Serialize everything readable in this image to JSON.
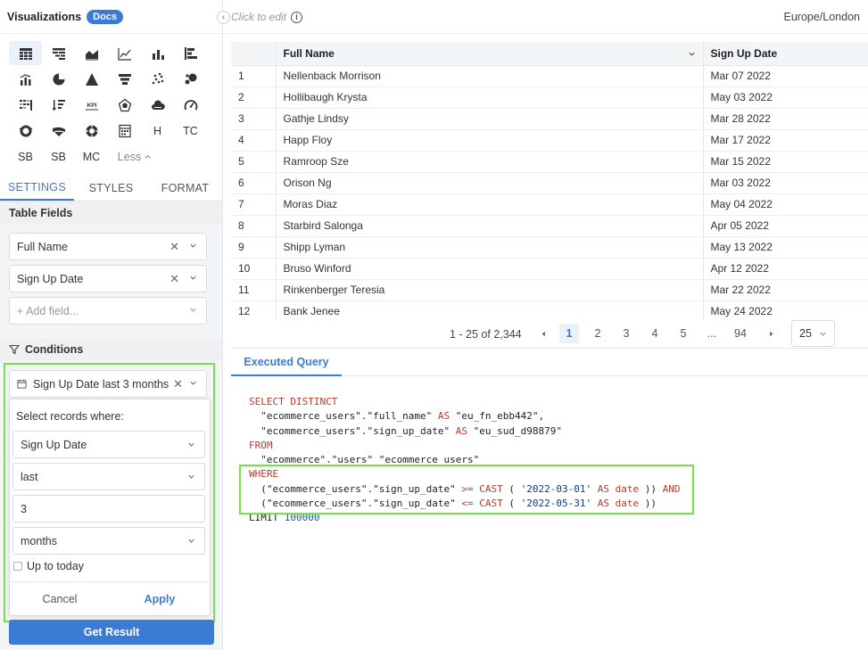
{
  "sidebar": {
    "title": "Visualizations",
    "docs_badge": "Docs",
    "viz_text_icons": [
      "H",
      "TC",
      "SB",
      "SB",
      "MC"
    ],
    "less_label": "Less",
    "tabs": [
      "SETTINGS",
      "STYLES",
      "FORMAT"
    ],
    "table_fields_title": "Table Fields",
    "fields": [
      "Full Name",
      "Sign Up Date"
    ],
    "add_field_placeholder": "+ Add field...",
    "conditions_title": "Conditions",
    "condition_chip": "Sign Up Date last 3 months",
    "popup": {
      "label": "Select records where:",
      "field": "Sign Up Date",
      "operator": "last",
      "value": "3",
      "unit": "months",
      "up_to_today": "Up to today",
      "cancel": "Cancel",
      "apply": "Apply"
    },
    "get_result": "Get Result"
  },
  "topbar": {
    "click_to_edit": "Click to edit",
    "timezone": "Europe/London"
  },
  "table": {
    "columns": [
      "Full Name",
      "Sign Up Date"
    ],
    "rows": [
      [
        "1",
        "Nellenback Morrison",
        "Mar 07 2022"
      ],
      [
        "2",
        "Hollibaugh Krysta",
        "May 03 2022"
      ],
      [
        "3",
        "Gathje Lindsy",
        "Mar 28 2022"
      ],
      [
        "4",
        "Happ Floy",
        "Mar 17 2022"
      ],
      [
        "5",
        "Ramroop Sze",
        "Mar 15 2022"
      ],
      [
        "6",
        "Orison Ng",
        "Mar 03 2022"
      ],
      [
        "7",
        "Moras Diaz",
        "May 04 2022"
      ],
      [
        "8",
        "Starbird Salonga",
        "Apr 05 2022"
      ],
      [
        "9",
        "Shipp Lyman",
        "May 13 2022"
      ],
      [
        "10",
        "Bruso Winford",
        "Apr 12 2022"
      ],
      [
        "11",
        "Rinkenberger Teresia",
        "Mar 22 2022"
      ],
      [
        "12",
        "Bank Jenee",
        "May 24 2022"
      ]
    ]
  },
  "pagination": {
    "summary": "1 - 25 of 2,344",
    "pages": [
      "1",
      "2",
      "3",
      "4",
      "5",
      "...",
      "94"
    ],
    "page_size": "25"
  },
  "query": {
    "tab_label": "Executed Query",
    "lines": [
      [
        [
          "kw",
          "SELECT DISTINCT"
        ]
      ],
      [
        [
          "id",
          "  \"ecommerce_users\".\"full_name\" "
        ],
        [
          "kw",
          "AS"
        ],
        [
          "id",
          " \"eu_fn_ebb442\","
        ]
      ],
      [
        [
          "id",
          "  \"ecommerce_users\".\"sign_up_date\" "
        ],
        [
          "kw",
          "AS"
        ],
        [
          "id",
          " \"eu_sud_d98879\""
        ]
      ],
      [
        [
          "kw",
          "FROM"
        ]
      ],
      [
        [
          "id",
          "  \"ecommerce\".\"users\" \"ecommerce_users\""
        ]
      ],
      [
        [
          "kw",
          "WHERE"
        ]
      ],
      [
        [
          "id",
          "  (\"ecommerce_users\".\"sign_up_date\" "
        ],
        [
          "kw",
          ">="
        ],
        [
          "id",
          " "
        ],
        [
          "kw",
          "CAST"
        ],
        [
          "id",
          " ( "
        ],
        [
          "str",
          "'2022-03-01'"
        ],
        [
          "id",
          " "
        ],
        [
          "kw",
          "AS"
        ],
        [
          "id",
          " "
        ],
        [
          "kw",
          "date"
        ],
        [
          "id",
          " )) "
        ],
        [
          "kw",
          "AND"
        ]
      ],
      [
        [
          "id",
          "  (\"ecommerce_users\".\"sign_up_date\" "
        ],
        [
          "kw",
          "<="
        ],
        [
          "id",
          " "
        ],
        [
          "kw",
          "CAST"
        ],
        [
          "id",
          " ( "
        ],
        [
          "str",
          "'2022-05-31'"
        ],
        [
          "id",
          " "
        ],
        [
          "kw",
          "AS"
        ],
        [
          "id",
          " "
        ],
        [
          "kw",
          "date"
        ],
        [
          "id",
          " ))"
        ]
      ],
      [
        [
          "id",
          "LIMIT "
        ],
        [
          "num",
          "100000"
        ]
      ]
    ]
  },
  "colors": {
    "accent": "#3a7bd5",
    "highlight_box": "#74e247"
  }
}
